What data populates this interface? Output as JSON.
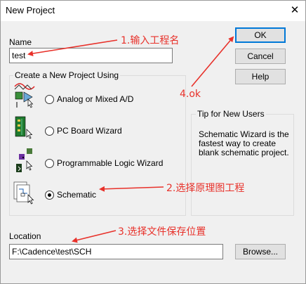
{
  "window": {
    "title": "New Project",
    "close_glyph": "✕"
  },
  "name": {
    "label": "Name",
    "value": "test"
  },
  "buttons": {
    "ok": "OK",
    "cancel": "Cancel",
    "help": "Help",
    "browse": "Browse..."
  },
  "project_types": {
    "group_title": "Create a New Project Using",
    "options": [
      {
        "label": "Analog or Mixed A/D",
        "checked": false,
        "icon": "analog-circuit-icon"
      },
      {
        "label": "PC Board Wizard",
        "checked": false,
        "icon": "pc-board-icon"
      },
      {
        "label": "Programmable Logic Wizard",
        "checked": false,
        "icon": "programmable-logic-icon"
      },
      {
        "label": "Schematic",
        "checked": true,
        "icon": "schematic-icon"
      }
    ]
  },
  "tip": {
    "title": "Tip for New Users",
    "text": "Schematic Wizard is the fastest way to create blank schematic project."
  },
  "location": {
    "label": "Location",
    "value": "F:\\Cadence\\test\\SCH"
  },
  "annotations": {
    "a1": "1.输入工程名",
    "a2": "2.选择原理图工程",
    "a3": "3.选择文件保存位置",
    "a4": "4.ok",
    "color": "#e8312a"
  },
  "colors": {
    "dialog_bg": "#f0f0f0",
    "default_button_border": "#0078d7"
  }
}
